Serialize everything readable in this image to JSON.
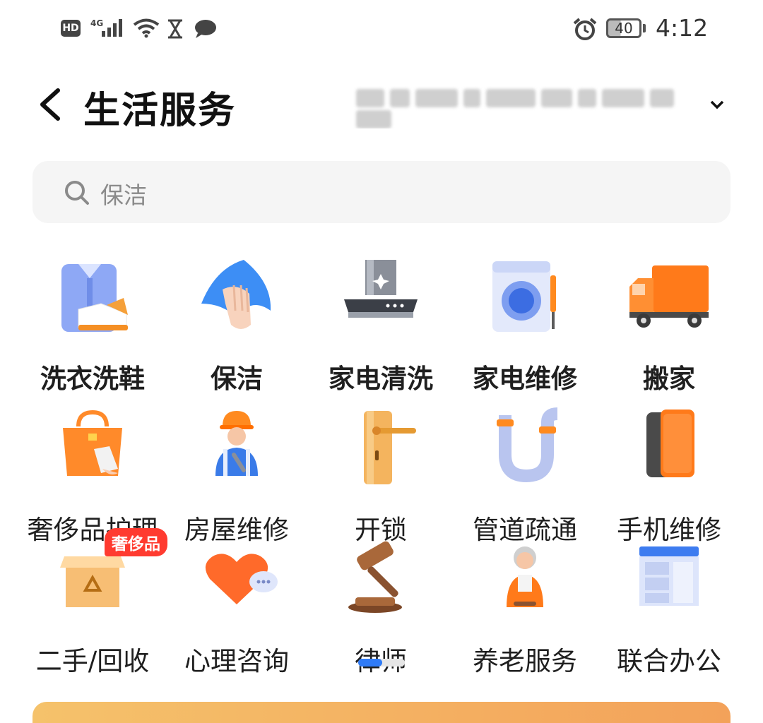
{
  "status": {
    "hd": "HD",
    "network": "4G",
    "battery": "40",
    "time": "4:12"
  },
  "header": {
    "title": "生活服务"
  },
  "search": {
    "placeholder": "保洁"
  },
  "services": [
    {
      "label": "洗衣洗鞋",
      "icon": "shirt-shoe-icon",
      "bold": true
    },
    {
      "label": "保洁",
      "icon": "cleaning-cloth-icon",
      "bold": true
    },
    {
      "label": "家电清洗",
      "icon": "range-hood-icon",
      "bold": true
    },
    {
      "label": "家电维修",
      "icon": "washing-machine-icon",
      "bold": true
    },
    {
      "label": "搬家",
      "icon": "truck-icon",
      "bold": true
    },
    {
      "label": "奢侈品护理",
      "icon": "handbag-icon",
      "bold": false
    },
    {
      "label": "房屋维修",
      "icon": "worker-icon",
      "bold": false
    },
    {
      "label": "开锁",
      "icon": "door-lock-icon",
      "bold": false
    },
    {
      "label": "管道疏通",
      "icon": "pipe-icon",
      "bold": false
    },
    {
      "label": "手机维修",
      "icon": "phone-icon",
      "bold": false
    },
    {
      "label": "二手/回收",
      "icon": "box-icon",
      "bold": false,
      "badge": "奢侈品"
    },
    {
      "label": "心理咨询",
      "icon": "heart-chat-icon",
      "bold": false
    },
    {
      "label": "律师",
      "icon": "gavel-icon",
      "bold": false
    },
    {
      "label": "养老服务",
      "icon": "elder-icon",
      "bold": false
    },
    {
      "label": "联合办公",
      "icon": "desk-icon",
      "bold": false
    }
  ],
  "pager": {
    "pages": 2,
    "current": 1
  },
  "colors": {
    "accent": "#2f7bf6",
    "badge": "#ff3b30",
    "orange": "#f97316"
  }
}
